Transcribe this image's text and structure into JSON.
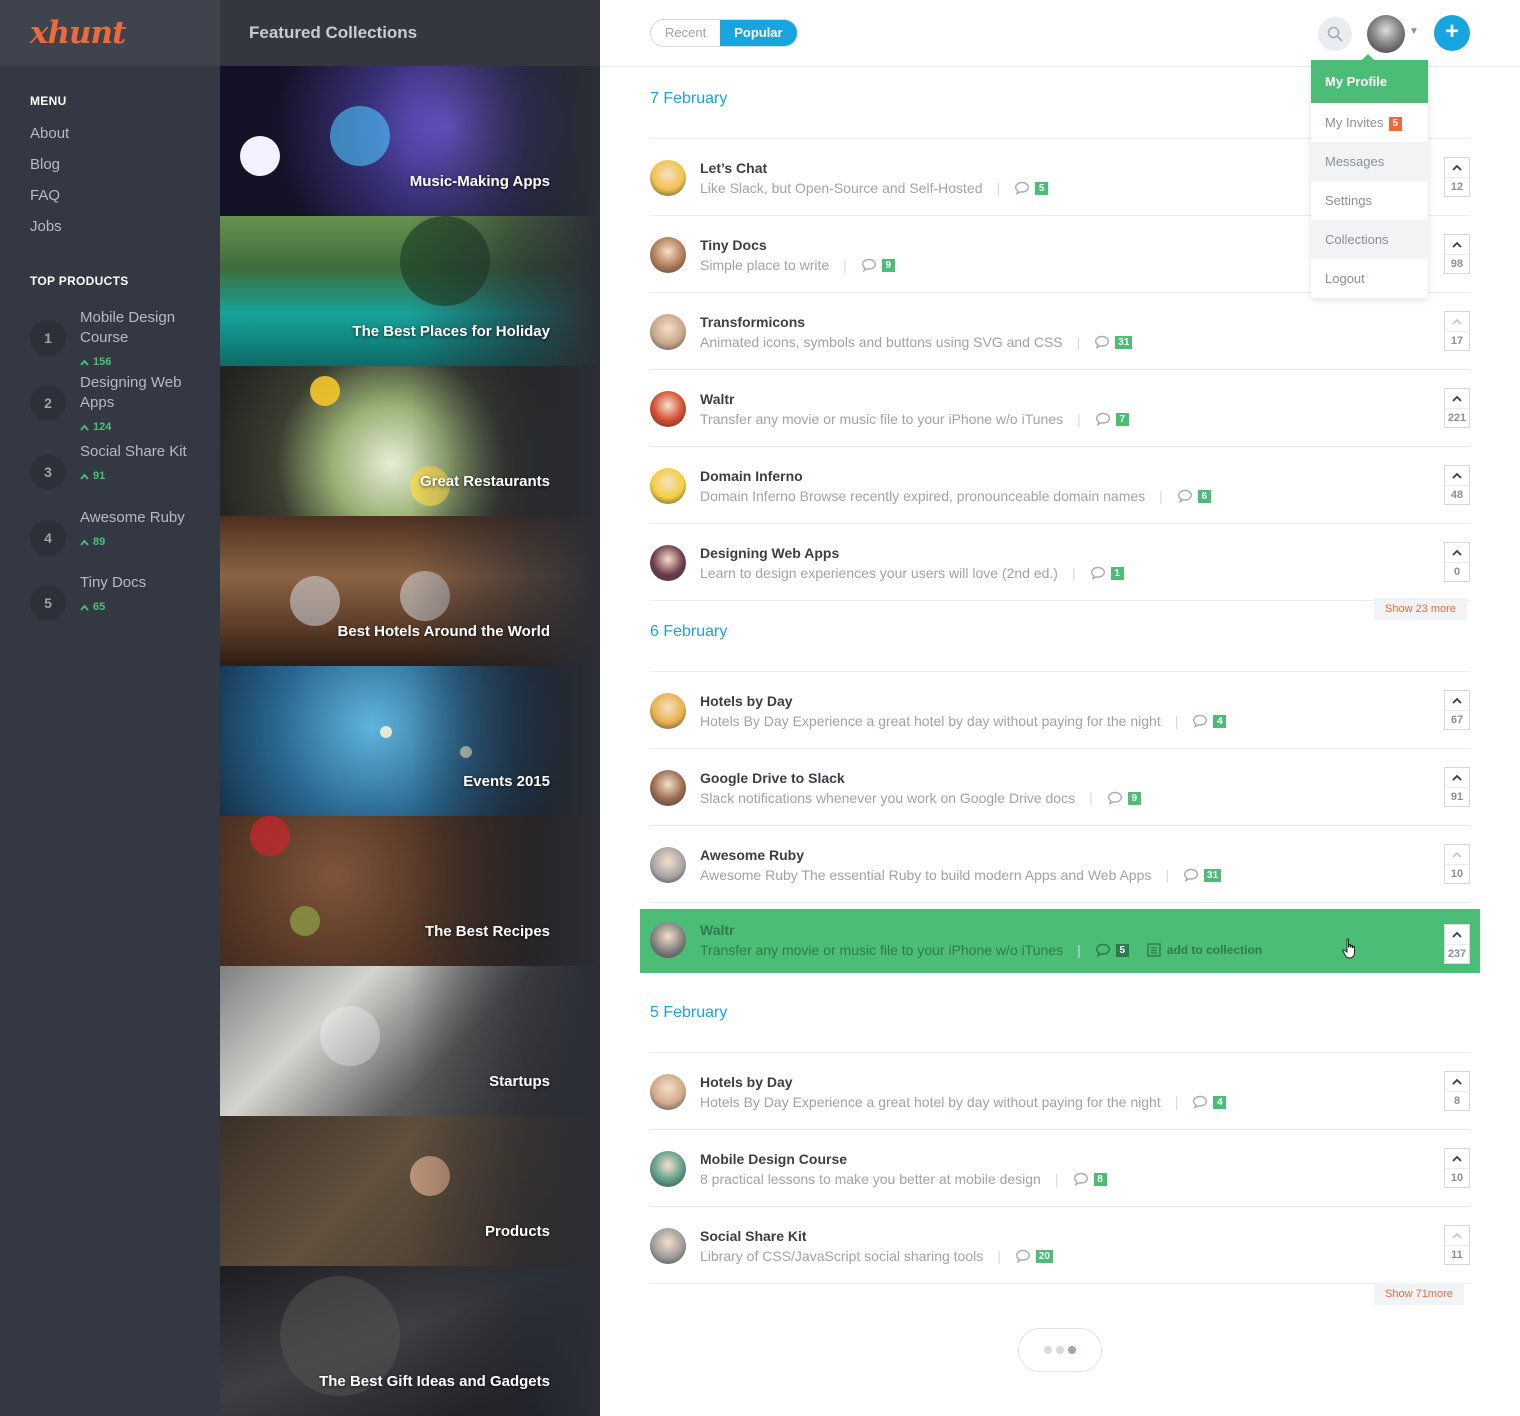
{
  "brand": {
    "logo": "xhunt",
    "accent": "#ef6a3b",
    "primary": "#18a5df",
    "success": "#4bbd77"
  },
  "sidebar": {
    "menu_heading": "MENU",
    "menu": [
      "About",
      "Blog",
      "FAQ",
      "Jobs"
    ],
    "top_heading": "TOP PRODUCTS",
    "top_products": [
      {
        "rank": "1",
        "title": "Mobile Design Course",
        "votes": "156"
      },
      {
        "rank": "2",
        "title": "Designing Web Apps",
        "votes": "124"
      },
      {
        "rank": "3",
        "title": "Social Share Kit",
        "votes": "91"
      },
      {
        "rank": "4",
        "title": "Awesome Ruby",
        "votes": "89"
      },
      {
        "rank": "5",
        "title": "Tiny Docs",
        "votes": "65"
      }
    ]
  },
  "collections": {
    "title": "Featured Collections",
    "items": [
      "Music-Making Apps",
      "The Best Places for Holiday",
      "Great Restaurants",
      "Best Hotels Around the World",
      "Events 2015",
      "The Best Recipes",
      "Startups",
      "Products",
      "The Best Gift Ideas and Gadgets"
    ]
  },
  "toolbar": {
    "tab_recent": "Recent",
    "tab_popular": "Popular",
    "active_tab": "Popular",
    "search_icon": "search-icon",
    "add_label": "+"
  },
  "dropdown": {
    "items": [
      {
        "label": "My Profile",
        "state": "active"
      },
      {
        "label": "My Invites",
        "badge": "5"
      },
      {
        "label": "Messages",
        "state": "shaded"
      },
      {
        "label": "Settings"
      },
      {
        "label": "Collections",
        "state": "shaded"
      },
      {
        "label": "Logout"
      }
    ]
  },
  "feed": {
    "days": [
      {
        "date": "7 February",
        "posts": [
          {
            "title": "Let’s Chat",
            "desc": "Like Slack, but Open-Source and Self-Hosted",
            "comments": "5",
            "votes": "12"
          },
          {
            "title": "Tiny Docs",
            "desc": "Simple place to write",
            "comments": "9",
            "votes": "98"
          },
          {
            "title": "Transformicons",
            "desc": "Animated icons, symbols and buttons using SVG and CSS",
            "comments": "31",
            "votes": "17"
          },
          {
            "title": "Waltr",
            "desc": "Transfer any movie or music file to your iPhone w/o iTunes",
            "comments": "7",
            "votes": "221"
          },
          {
            "title": "Domain Inferno",
            "desc": "Domain Inferno Browse recently expired, pronounceable domain names",
            "comments": "6",
            "votes": "48"
          },
          {
            "title": "Designing Web Apps",
            "desc": "Learn to design experiences your users will love (2nd ed.)",
            "comments": "1",
            "votes": "0"
          }
        ],
        "show_more": "Show 23 more"
      },
      {
        "date": "6 February",
        "posts": [
          {
            "title": "Hotels by Day",
            "desc": "Hotels By Day Experience a great hotel by day without paying for the night",
            "comments": "4",
            "votes": "67"
          },
          {
            "title": "Google Drive to Slack",
            "desc": "Slack notifications whenever you work on Google Drive docs",
            "comments": "9",
            "votes": "91"
          },
          {
            "title": "Awesome Ruby",
            "desc": "Awesome Ruby The essential Ruby to build modern Apps and Web Apps",
            "comments": "31",
            "votes": "10"
          },
          {
            "title": "Waltr",
            "desc": "Transfer any movie or music file to your iPhone w/o iTunes",
            "comments": "5",
            "votes": "237",
            "action": "add to collection"
          }
        ]
      },
      {
        "date": "5 February",
        "posts": [
          {
            "title": "Hotels by Day",
            "desc": "Hotels By Day Experience a great hotel by day without paying for the night",
            "comments": "4",
            "votes": "8"
          },
          {
            "title": "Mobile Design Course",
            "desc": "8 practical lessons to make you better at mobile design",
            "comments": "8",
            "votes": "10"
          },
          {
            "title": "Social Share Kit",
            "desc": "Library of CSS/JavaScript social sharing tools",
            "comments": "20",
            "votes": "11"
          }
        ],
        "show_more": "Show 71more"
      }
    ]
  }
}
